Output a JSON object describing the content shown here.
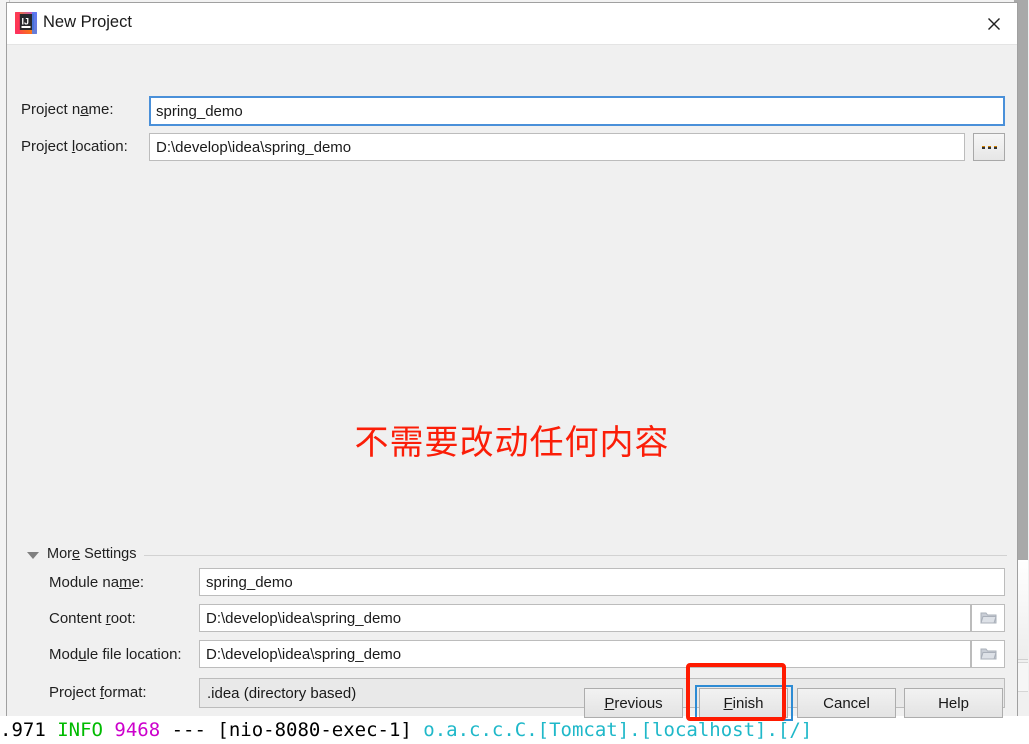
{
  "window": {
    "title": "New Project",
    "app_icon": "intellij-idea-icon",
    "close_icon": "close-icon"
  },
  "form": {
    "project_name": {
      "label_pre": "Project n",
      "label_mnemonic": "a",
      "label_post": "me:",
      "value": "spring_demo",
      "placeholder": ""
    },
    "project_location": {
      "label_pre": "Project ",
      "label_mnemonic": "l",
      "label_post": "ocation:",
      "value": "D:\\develop\\idea\\spring_demo",
      "placeholder": "",
      "browse_button": "..."
    }
  },
  "annotation": {
    "text": "不需要改动任何内容",
    "color": "#fb1e08"
  },
  "more_settings": {
    "header_pre": "Mor",
    "header_mnemonic": "e",
    "header_post": " Settings",
    "expanded": true,
    "fields": {
      "module_name": {
        "label_pre": "Module na",
        "label_mnemonic": "m",
        "label_post": "e:",
        "value": "spring_demo"
      },
      "content_root": {
        "label_pre": "Content ",
        "label_mnemonic": "r",
        "label_post": "oot:",
        "value": "D:\\develop\\idea\\spring_demo",
        "browse_icon": "folder-icon"
      },
      "module_file_location": {
        "label_pre": "Mod",
        "label_mnemonic": "u",
        "label_post": "le file location:",
        "value": "D:\\develop\\idea\\spring_demo",
        "browse_icon": "folder-icon"
      },
      "project_format": {
        "label_pre": "Project ",
        "label_mnemonic": "f",
        "label_post": "ormat:",
        "value": ".idea (directory based)",
        "chevron_icon": "chevron-down-icon"
      }
    }
  },
  "buttons": {
    "previous": {
      "pre": "",
      "mnemonic": "P",
      "post": "revious"
    },
    "finish": {
      "pre": "",
      "mnemonic": "F",
      "post": "inish",
      "focused": true,
      "highlight_color": "#ff1a00"
    },
    "cancel": {
      "pre": "Cancel",
      "mnemonic": "",
      "post": ""
    },
    "help": {
      "pre": "Help",
      "mnemonic": "",
      "post": ""
    }
  },
  "console": {
    "segments": [
      {
        "text": ".971 ",
        "color": "#000000"
      },
      {
        "text": " INFO ",
        "color": "#00bb00"
      },
      {
        "text": "9468 ",
        "color": "#cc00cc"
      },
      {
        "text": "--- ",
        "color": "#000000"
      },
      {
        "text": "[nio-8080-exec-1] ",
        "color": "#000000"
      },
      {
        "text": "o.a.c.c.C.[Tomcat].[localhost].[/]",
        "color": "#1fb8c9"
      }
    ]
  }
}
